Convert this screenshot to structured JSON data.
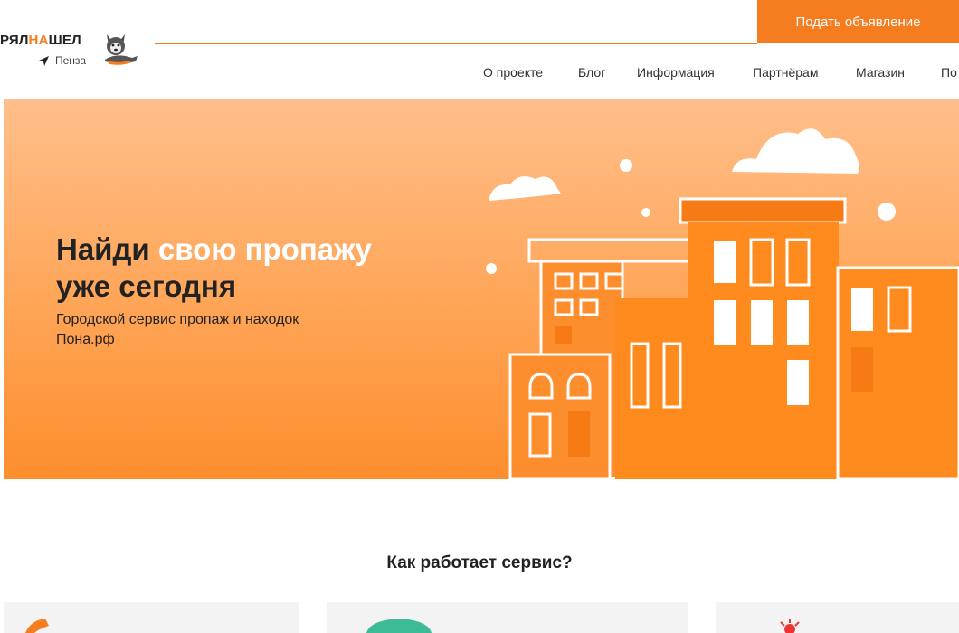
{
  "header": {
    "logo_part1": "РЯЛ",
    "logo_accent": "НА",
    "logo_part2": "ШЕЛ",
    "city": "Пенза",
    "post_button": "Подать объявление"
  },
  "nav": {
    "items": [
      "О проекте",
      "Блог",
      "Информация",
      "Партнёрам",
      "Магазин",
      "По"
    ]
  },
  "hero": {
    "title_plain": "Найди",
    "title_highlight": "свою пропажу",
    "title_line2": "уже сегодня",
    "subtitle_line1": "Городской сервис пропаж и находок",
    "subtitle_line2": "Пона.рф"
  },
  "how": {
    "title": "Как работает сервис?"
  },
  "colors": {
    "accent": "#f57c1f",
    "hero_top": "#ffbf8a",
    "hero_bottom": "#fd8e2d",
    "building": "#ff8a1e"
  },
  "icons": {
    "location": "location-arrow-icon",
    "mascot": "husky-mascot-icon"
  }
}
